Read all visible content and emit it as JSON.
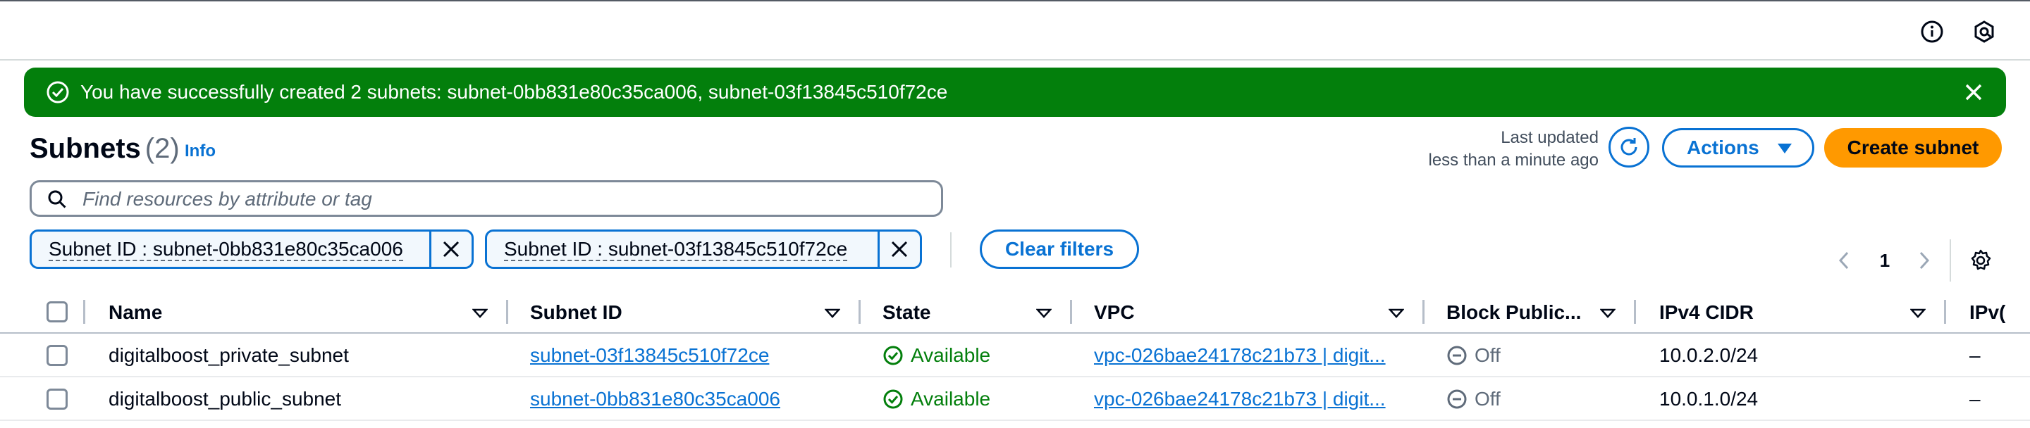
{
  "topbar": {
    "icons": [
      "info-circle-icon",
      "cloudshell-hexagon-icon"
    ]
  },
  "flash": {
    "message": "You have successfully created 2 subnets: subnet-0bb831e80c35ca006, subnet-03f13845c510f72ce",
    "type": "success",
    "color": "#037f0c"
  },
  "header": {
    "title": "Subnets",
    "count": "(2)",
    "info_label": "Info",
    "last_updated_label": "Last updated",
    "last_updated_value": "less than a minute ago",
    "actions_label": "Actions",
    "create_label": "Create subnet"
  },
  "search": {
    "placeholder": "Find resources by attribute or tag"
  },
  "filters": [
    {
      "label": "Subnet ID : subnet-0bb831e80c35ca006"
    },
    {
      "label": "Subnet ID : subnet-03f13845c510f72ce"
    }
  ],
  "clear_filters_label": "Clear filters",
  "pagination": {
    "current_page": "1"
  },
  "table": {
    "columns": [
      "Name",
      "Subnet ID",
      "State",
      "VPC",
      "Block Public...",
      "IPv4 CIDR",
      "IPv("
    ],
    "rows": [
      {
        "name": "digitalboost_private_subnet",
        "subnet_id": "subnet-03f13845c510f72ce",
        "state": "Available",
        "vpc": "vpc-026bae24178c21b73 | digit...",
        "block_public": "Off",
        "ipv4_cidr": "10.0.2.0/24",
        "ipv6": "–"
      },
      {
        "name": "digitalboost_public_subnet",
        "subnet_id": "subnet-0bb831e80c35ca006",
        "state": "Available",
        "vpc": "vpc-026bae24178c21b73 | digit...",
        "block_public": "Off",
        "ipv4_cidr": "10.0.1.0/24",
        "ipv6": "–"
      }
    ]
  },
  "colors": {
    "link": "#0972d3",
    "primary_button": "#ff9900",
    "success": "#037f0c",
    "muted": "#5f6b7a"
  }
}
